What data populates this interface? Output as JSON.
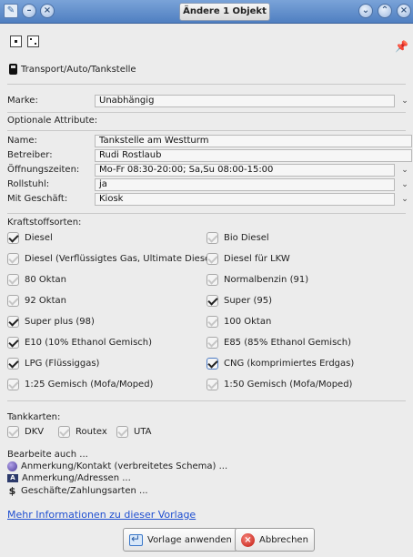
{
  "window": {
    "title": "Ändere 1 Objekt",
    "left_controls": [
      "app-icon",
      "minimize-icon",
      "close-icon"
    ],
    "right_controls": [
      "chevron-down-icon",
      "chevron-up-icon",
      "close-icon"
    ]
  },
  "preset": {
    "path": "Transport/Auto/Tankstelle",
    "icons": [
      "node-type-icon",
      "way-type-icon",
      "pin-icon",
      "fuel-pump-icon"
    ]
  },
  "marke": {
    "label": "Marke:",
    "value": "Unabhängig"
  },
  "optional_title": "Optionale Attribute:",
  "attributes": [
    {
      "label": "Name:",
      "value": "Tankstelle am Westturm",
      "combo": false
    },
    {
      "label": "Betreiber:",
      "value": "Rudi Rostlaub",
      "combo": false
    },
    {
      "label": "Öffnungszeiten:",
      "value": "Mo-Fr 08:30-20:00; Sa,Su 08:00-15:00",
      "combo": true
    },
    {
      "label": "Rollstuhl:",
      "value": "ja",
      "combo": true
    },
    {
      "label": "Mit Geschäft:",
      "value": "Kiosk",
      "combo": true
    }
  ],
  "fuel_title": "Kraftstoffsorten:",
  "fuels_left": [
    {
      "label": "Diesel",
      "state": "checked"
    },
    {
      "label": "Diesel (Verflüssigtes Gas, Ultimate Diesel)",
      "state": "dim"
    },
    {
      "label": "80 Oktan",
      "state": "dim"
    },
    {
      "label": "92 Oktan",
      "state": "dim"
    },
    {
      "label": "Super plus (98)",
      "state": "checked"
    },
    {
      "label": "E10 (10% Ethanol Gemisch)",
      "state": "checked"
    },
    {
      "label": "LPG (Flüssiggas)",
      "state": "checked"
    },
    {
      "label": "1:25 Gemisch (Mofa/Moped)",
      "state": "dim"
    }
  ],
  "fuels_right": [
    {
      "label": "Bio Diesel",
      "state": "dim"
    },
    {
      "label": "Diesel für LKW",
      "state": "dim"
    },
    {
      "label": "Normalbenzin (91)",
      "state": "dim"
    },
    {
      "label": "Super (95)",
      "state": "checked"
    },
    {
      "label": "100 Oktan",
      "state": "dim"
    },
    {
      "label": "E85 (85% Ethanol Gemisch)",
      "state": "dim"
    },
    {
      "label": "CNG (komprimiertes Erdgas)",
      "state": "checked-focus"
    },
    {
      "label": "1:50 Gemisch (Mofa/Moped)",
      "state": "dim"
    }
  ],
  "cards_title": "Tankkarten:",
  "cards": [
    {
      "label": "DKV",
      "state": "dim"
    },
    {
      "label": "Routex",
      "state": "dim"
    },
    {
      "label": "UTA",
      "state": "dim"
    }
  ],
  "edit_also": {
    "title": "Bearbeite auch ...",
    "links": [
      {
        "label": "Anmerkung/Kontakt (verbreitetes Schema) ...",
        "icon": "contact-icon"
      },
      {
        "label": "Anmerkung/Adressen ...",
        "icon": "address-icon"
      },
      {
        "label": "Geschäfte/Zahlungsarten ...",
        "icon": "dollar-icon"
      }
    ]
  },
  "more_info": "Mehr Informationen zu dieser Vorlage",
  "buttons": {
    "apply": "Vorlage anwenden",
    "cancel": "Abbrechen"
  }
}
